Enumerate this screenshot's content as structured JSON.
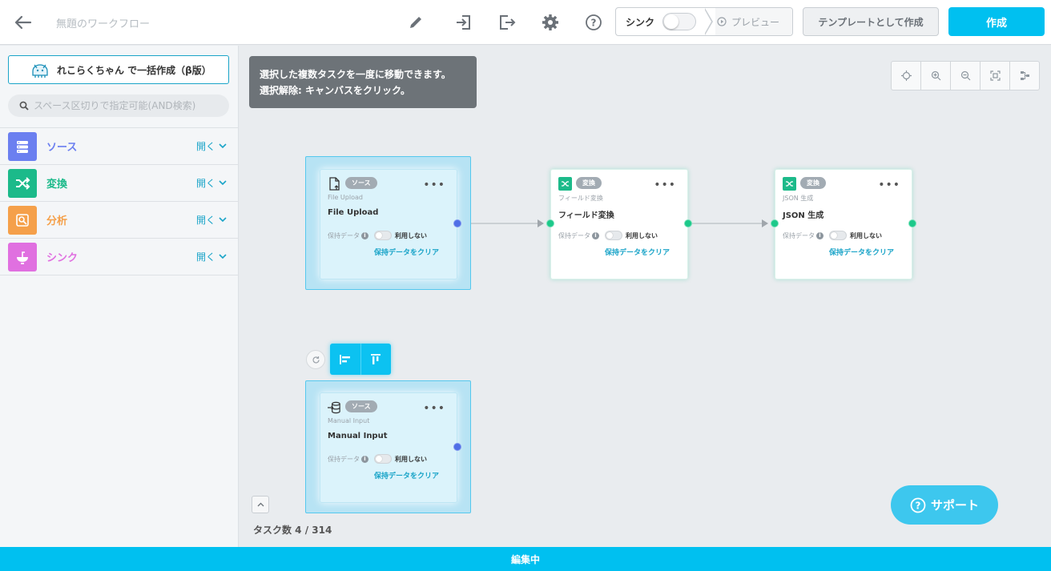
{
  "header": {
    "workflow_title": "無題のワークフロー",
    "sync_label": "シンク",
    "preview_label": "プレビュー",
    "template_label": "テンプレートとして作成",
    "create_label": "作成",
    "icons": [
      "back-arrow-icon",
      "pencil-icon",
      "import-icon",
      "export-icon",
      "gear-icon",
      "help-icon"
    ]
  },
  "sidebar": {
    "bulk_create_label": "れこらくちゃん で一括作成（β版）",
    "search_placeholder": "スペース区切りで指定可能(AND検索)",
    "categories": [
      {
        "label": "ソース",
        "toggle": "開く",
        "color": "#6b7ff0",
        "icon": "database-icon"
      },
      {
        "label": "変換",
        "toggle": "開く",
        "color": "#1cba8a",
        "icon": "shuffle-icon"
      },
      {
        "label": "分析",
        "toggle": "開く",
        "color": "#f5a04a",
        "icon": "analysis-icon"
      },
      {
        "label": "シンク",
        "toggle": "開く",
        "color": "#e070e0",
        "icon": "sink-icon"
      }
    ]
  },
  "canvas": {
    "tooltip_line1": "選択した複数タスクを一度に移動できます。",
    "tooltip_line2": "選択解除: キャンバスをクリック。",
    "task_count": "タスク数 4 / 314",
    "support_label": "サポート",
    "nodes": [
      {
        "badge": "ソース",
        "subtitle": "File Upload",
        "title": "File Upload",
        "retain_label": "保持データ",
        "switch_label": "利用しない",
        "clear_label": "保持データをクリア",
        "icon": "file-upload-icon"
      },
      {
        "badge": "変換",
        "subtitle": "フィールド変換",
        "title": "フィールド変換",
        "retain_label": "保持データ",
        "switch_label": "利用しない",
        "clear_label": "保持データをクリア",
        "icon": "transform-icon"
      },
      {
        "badge": "変換",
        "subtitle": "JSON 生成",
        "title": "JSON 生成",
        "retain_label": "保持データ",
        "switch_label": "利用しない",
        "clear_label": "保持データをクリア",
        "icon": "transform-icon"
      },
      {
        "badge": "ソース",
        "subtitle": "Manual Input",
        "title": "Manual Input",
        "retain_label": "保持データ",
        "switch_label": "利用しない",
        "clear_label": "保持データをクリア",
        "icon": "manual-input-icon"
      }
    ]
  },
  "status": {
    "label": "編集中"
  },
  "colors": {
    "accent": "#00c0f0",
    "port_green": "#1cc98a",
    "port_blue": "#4f6fe6"
  }
}
